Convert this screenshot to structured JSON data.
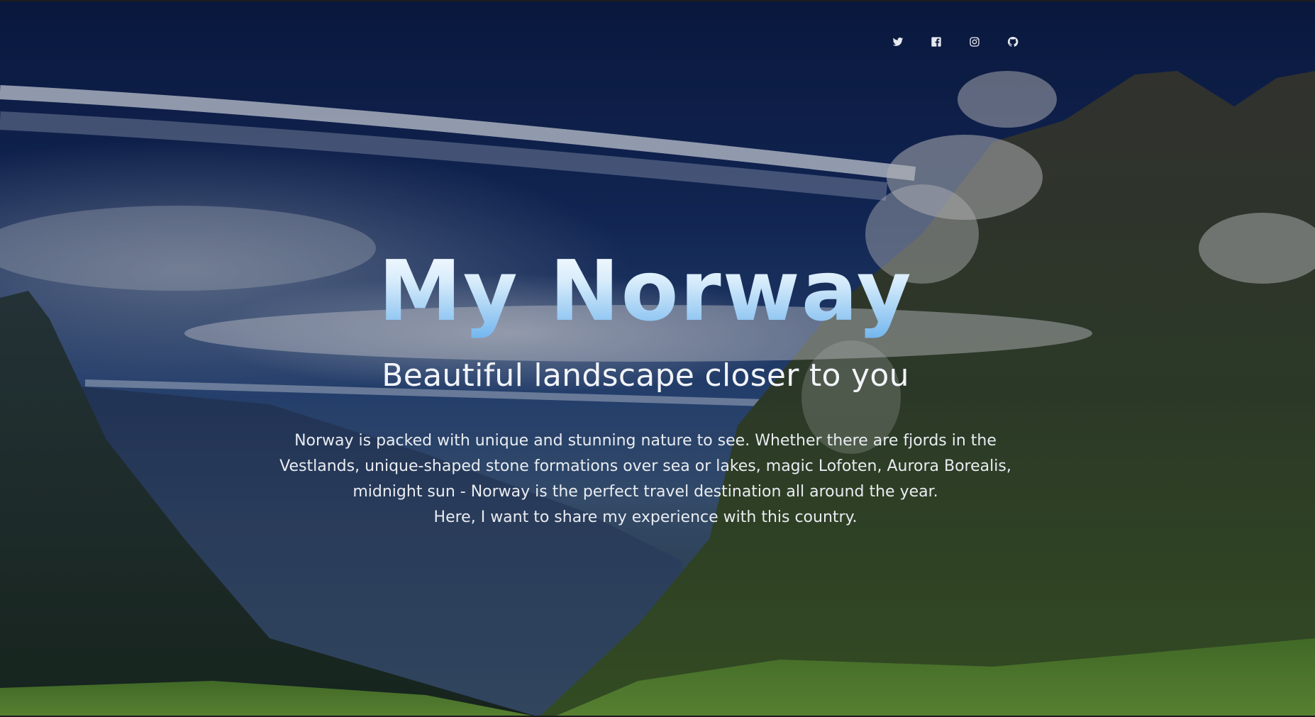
{
  "hero": {
    "title": "My Norway",
    "subtitle": "Beautiful landscape closer to you",
    "description_lines": [
      "Norway is packed with unique and stunning nature to see. Whether there are fjords in the",
      "Vestlands, unique-shaped stone formations over sea or lakes, magic Lofoten, Aurora Borealis,",
      "midnight sun - Norway is the perfect travel destination all around the year.",
      "Here, I want to share my experience with this country."
    ]
  },
  "socials": [
    {
      "icon": "twitter-icon"
    },
    {
      "icon": "facebook-icon"
    },
    {
      "icon": "instagram-icon"
    },
    {
      "icon": "github-icon"
    }
  ],
  "colors": {
    "sky": "#0b1b45",
    "title_gradient_top": "#ffffff",
    "title_gradient_bottom": "#6fb4ee",
    "text": "#e9ecf1"
  }
}
